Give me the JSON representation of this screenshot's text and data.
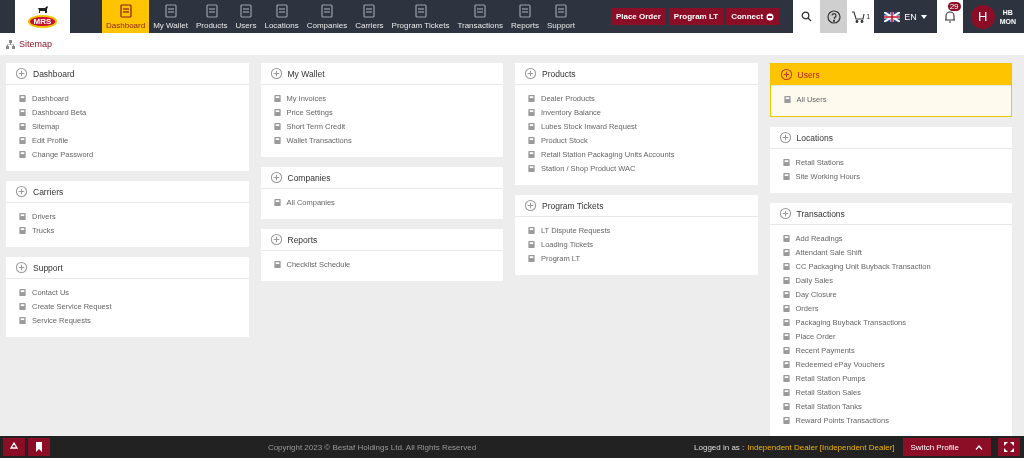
{
  "nav": {
    "logo_text": "MRS",
    "items": [
      {
        "label": "Dashboard",
        "selected": true
      },
      {
        "label": "My Wallet",
        "selected": false
      },
      {
        "label": "Products",
        "selected": false
      },
      {
        "label": "Users",
        "selected": false
      },
      {
        "label": "Locations",
        "selected": false
      },
      {
        "label": "Companies",
        "selected": false
      },
      {
        "label": "Carriers",
        "selected": false
      },
      {
        "label": "Program Tickets",
        "selected": false
      },
      {
        "label": "Transactions",
        "selected": false
      },
      {
        "label": "Reports",
        "selected": false
      },
      {
        "label": "Support",
        "selected": false
      }
    ],
    "actions": [
      "Place Order",
      "Program LT",
      "Connect"
    ],
    "cart_count": "1",
    "language": "EN",
    "notifications": "29",
    "avatar": "H",
    "user_lines": [
      "HB",
      "MON"
    ]
  },
  "breadcrumb": "Sitemap",
  "columns": [
    [
      {
        "title": "Dashboard",
        "selected": false,
        "items": [
          "Dashboard",
          "Dashboard Beta",
          "Sitemap",
          "Edit Profile",
          "Change Password"
        ]
      },
      {
        "title": "Carriers",
        "selected": false,
        "items": [
          "Drivers",
          "Trucks"
        ]
      },
      {
        "title": "Support",
        "selected": false,
        "items": [
          "Contact Us",
          "Create Service Request",
          "Service Requests"
        ]
      }
    ],
    [
      {
        "title": "My Wallet",
        "selected": false,
        "items": [
          "My Invoices",
          "Price Settings",
          "Short Term Credit",
          "Wallet Transactions"
        ]
      },
      {
        "title": "Companies",
        "selected": false,
        "items": [
          "All Companies"
        ]
      },
      {
        "title": "Reports",
        "selected": false,
        "items": [
          "Checklist Schedule"
        ]
      }
    ],
    [
      {
        "title": "Products",
        "selected": false,
        "items": [
          "Dealer Products",
          "Inventory Balance",
          "Lubes Stock Inward Request",
          "Product Stock",
          "Retail Station Packaging Units Accounts",
          "Station / Shop Product WAC"
        ]
      },
      {
        "title": "Program Tickets",
        "selected": false,
        "items": [
          "LT Dispute Requests",
          "Loading Tickets",
          "Program LT"
        ]
      }
    ],
    [
      {
        "title": "Users",
        "selected": true,
        "items": [
          "All Users"
        ]
      },
      {
        "title": "Locations",
        "selected": false,
        "items": [
          "Retail Stations",
          "Site Working Hours"
        ]
      },
      {
        "title": "Transactions",
        "selected": false,
        "items": [
          "Add Readings",
          "Attendant Sale Shift",
          "CC Packaging Unit Buyback Transaction",
          "Daily Sales",
          "Day Closure",
          "Orders",
          "Packaging Buyback Transactions",
          "Place Order",
          "Recent Payments",
          "Redeemed ePay Vouchers",
          "Retail Station Pumps",
          "Retail Station Sales",
          "Retail Station Tanks",
          "Reward Points Transactions"
        ]
      }
    ]
  ],
  "footer": {
    "copyright": "Copyright 2023 © Bestaf Holdings Ltd. All Rights Reserved",
    "logged_in_label": "Logged in as :",
    "account": "Independent Dealer [Independent Dealer]",
    "switch_profile": "Switch Profile"
  }
}
